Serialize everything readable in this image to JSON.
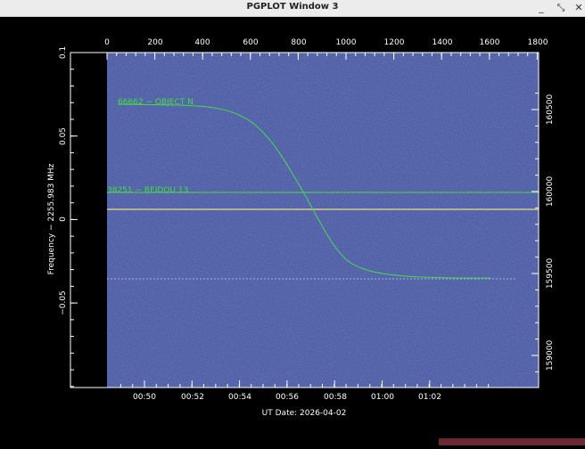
{
  "window": {
    "title": "PGPLOT Window 3"
  },
  "icons": {
    "minimize": "minimize-icon",
    "maximize": "maximize-icon",
    "close": "close-icon"
  },
  "plot": {
    "xlabel": "UT Date: 2026-04-02",
    "ylabel": "Frequency − 2255.983 MHz",
    "top_ticks": [
      "0",
      "200",
      "400",
      "600",
      "800",
      "1000",
      "1200",
      "1400",
      "1600",
      "1800"
    ],
    "bottom_ticks": [
      "00:50",
      "00:52",
      "00:54",
      "00:56",
      "00:58",
      "01:00",
      "01:02"
    ],
    "left_ticks": [
      "0.1",
      "0.05",
      "0",
      "−0.05"
    ],
    "right_ticks": [
      "160500",
      "160000",
      "159500",
      "159000"
    ],
    "annotations": [
      {
        "text": "66662 − OBJECT N",
        "color": "#44dd44"
      },
      {
        "text": "38251 − BEIDOU 13",
        "color": "#44dd44"
      }
    ],
    "colors": {
      "waterfall_bg": "#3a4b9a",
      "track_line": "#44dd44",
      "signal_line": "#d6c98a",
      "frame": "#ffffff",
      "text": "#ffffff"
    }
  }
}
